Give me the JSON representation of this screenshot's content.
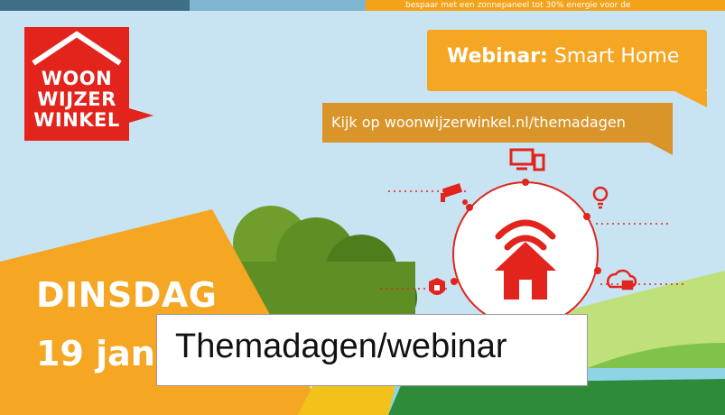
{
  "top_strip": {
    "fragment_text": "bespaar met een zonnepaneel tot 30% energie voor de"
  },
  "logo": {
    "lines": [
      "WOON",
      "WIJZER",
      "WINKEL"
    ],
    "color": "#e2241d"
  },
  "banner_main": {
    "bold_label": "Webinar:",
    "label": " Smart Home"
  },
  "banner_sub": {
    "label": "Kijk op woonwijzerwinkel.nl/themadagen"
  },
  "date": {
    "line1": "DINSDAG",
    "line2": "19 jan"
  },
  "caption": {
    "label": "Themadagen/webinar"
  },
  "icons": [
    "devices-icon",
    "lightbulb-icon",
    "cloud-media-icon",
    "shield-lock-icon",
    "security-camera-icon",
    "wifi-house-icon"
  ],
  "colors": {
    "sky": "#c8e3f2",
    "orange": "#f5a623",
    "dark_orange": "#d9952a",
    "red": "#e2241d",
    "green": "#2e8b3a"
  }
}
